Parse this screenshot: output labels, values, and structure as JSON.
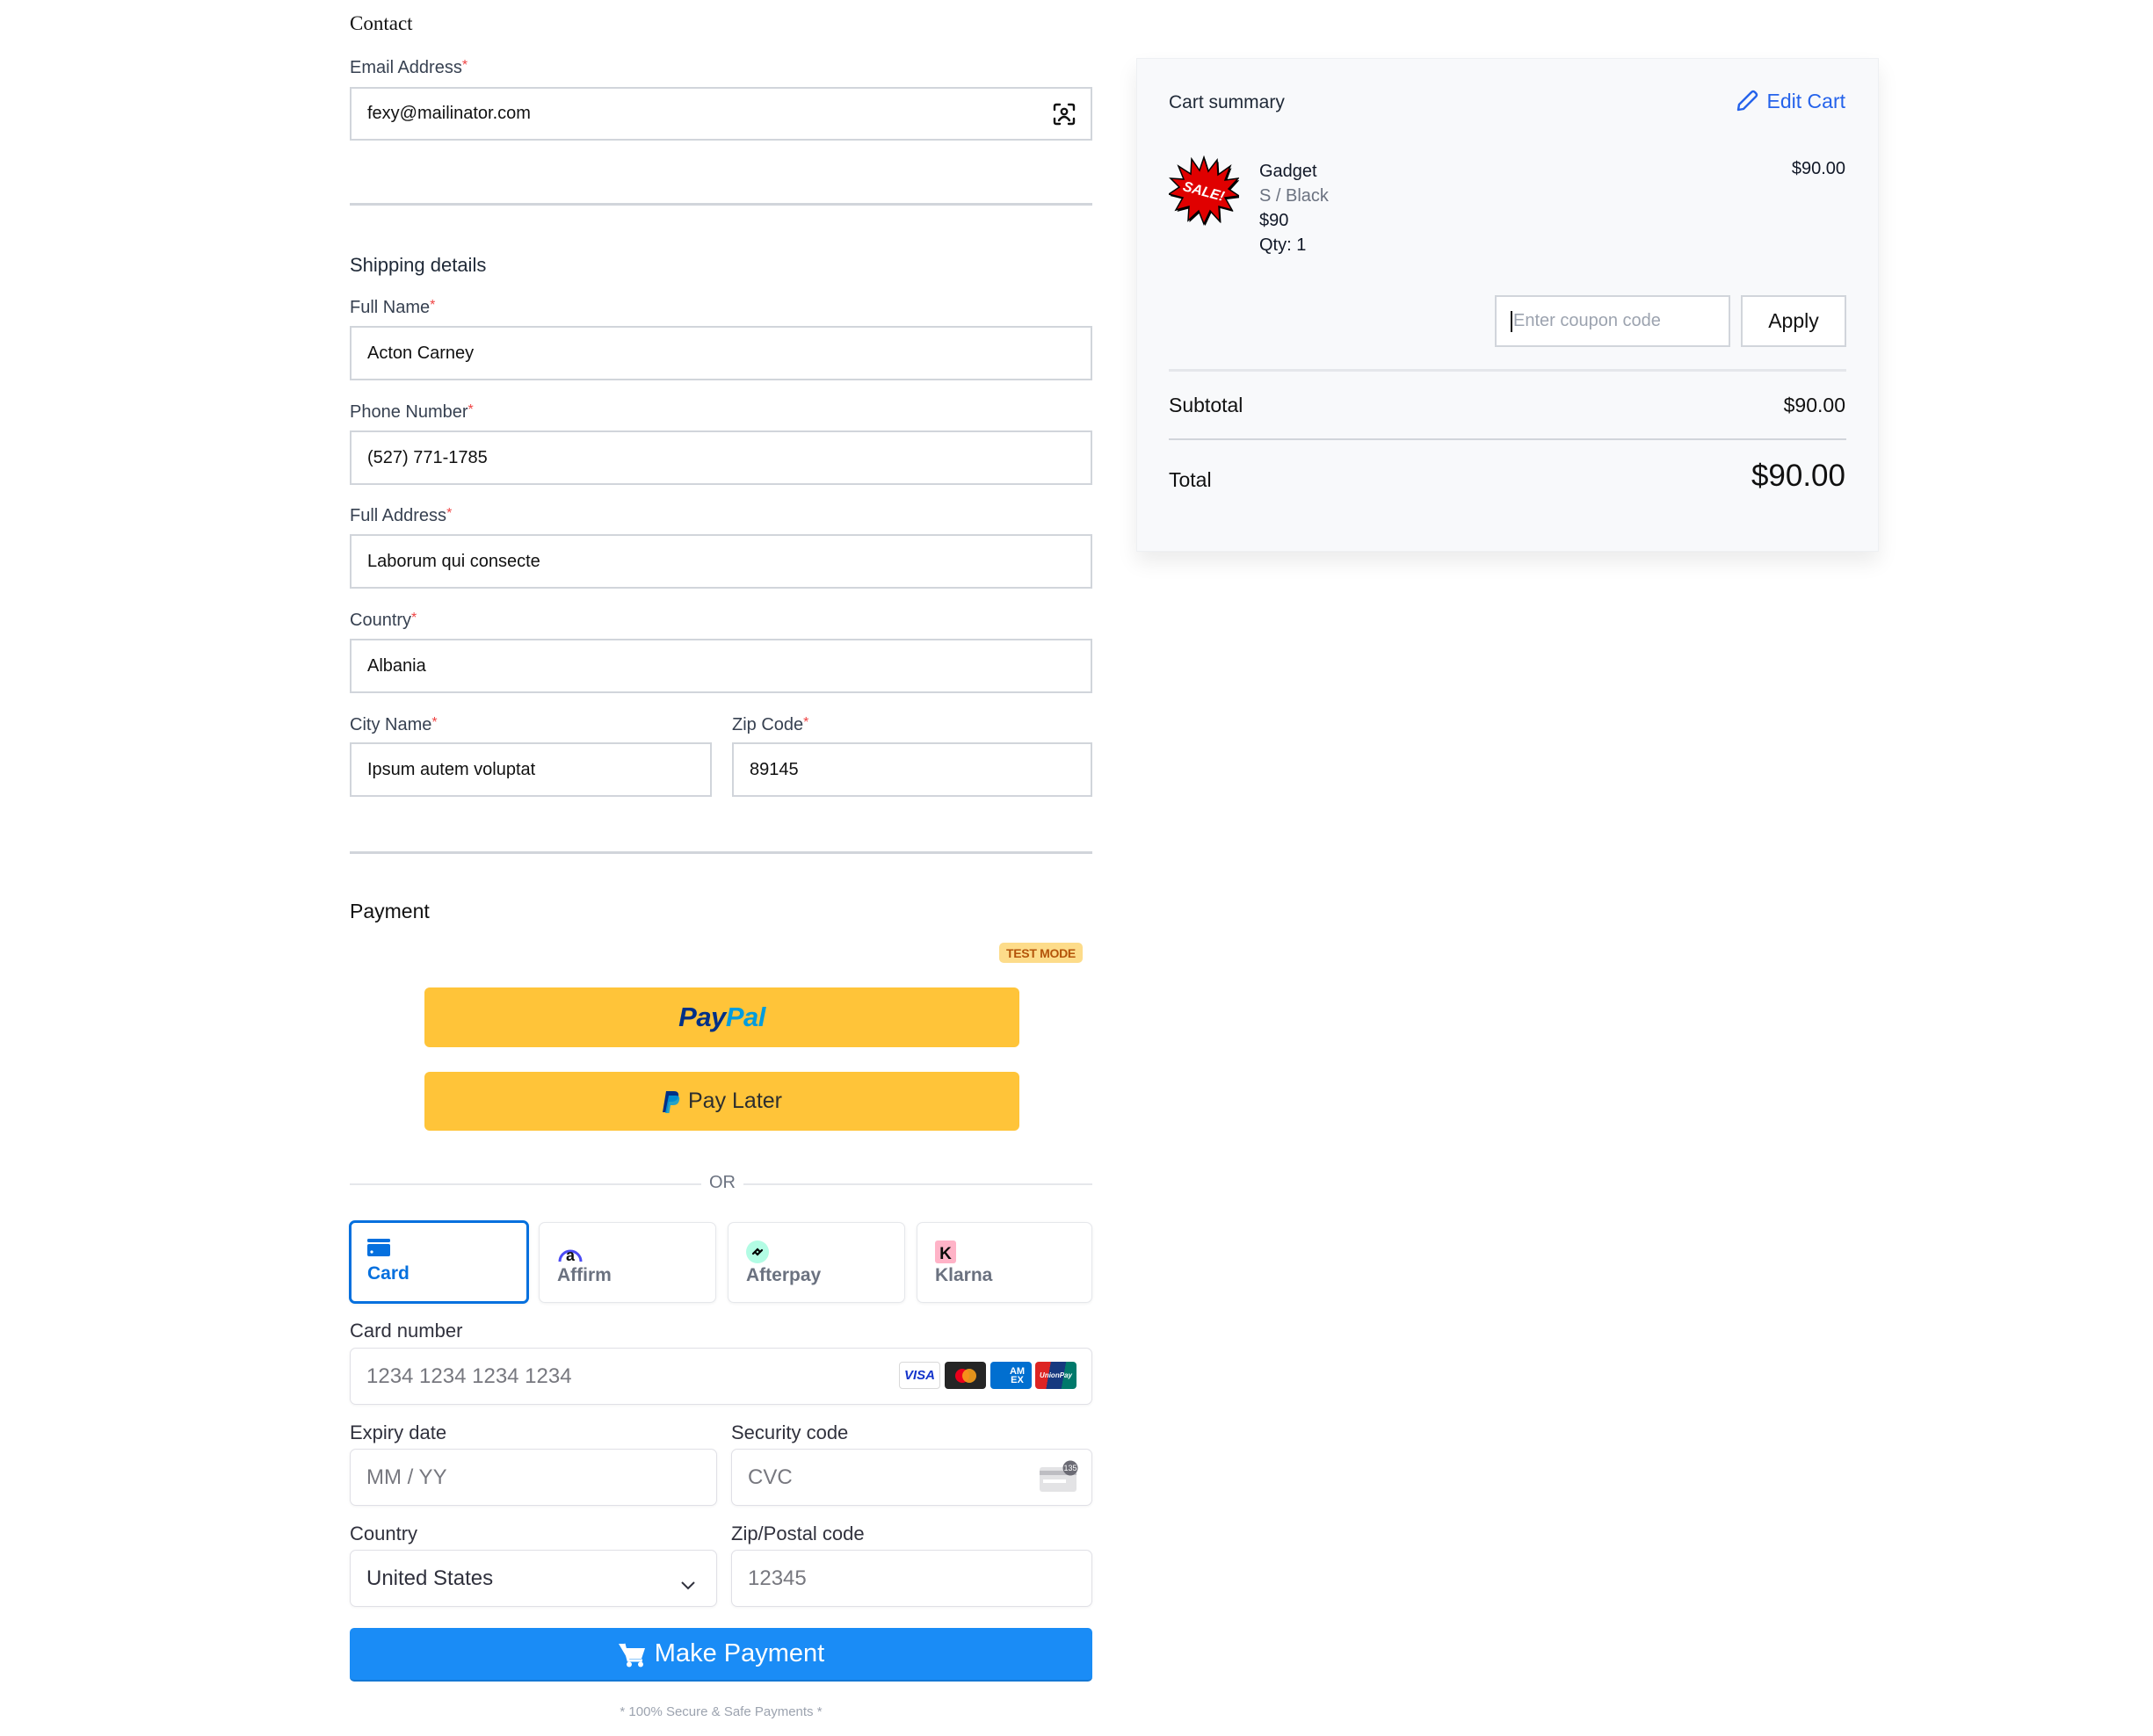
{
  "contact": {
    "title": "Contact",
    "email_label": "Email Address",
    "required_mark": "*",
    "email_value": "fexy@mailinator.com",
    "email_icon": "contact-autofill-icon"
  },
  "shipping": {
    "title": "Shipping details",
    "full_name_label": "Full Name",
    "full_name_value": "Acton Carney",
    "phone_label": "Phone Number",
    "phone_value": "(527) 771-1785",
    "address_label": "Full Address",
    "address_value": "Laborum qui consecte",
    "country_label": "Country",
    "country_value": "Albania",
    "city_label": "City Name",
    "city_value": "Ipsum autem voluptat",
    "zip_label": "Zip Code",
    "zip_value": "89145"
  },
  "payment": {
    "title": "Payment",
    "test_mode_badge": "TEST MODE",
    "paypal_button": {
      "pay": "Pay",
      "pal": "Pal"
    },
    "pay_later_button": "Pay Later",
    "or_separator": "OR",
    "methods": [
      {
        "label": "Card",
        "icon": "card-icon",
        "active": true
      },
      {
        "label": "Affirm",
        "icon": "affirm-icon",
        "active": false
      },
      {
        "label": "Afterpay",
        "icon": "afterpay-icon",
        "active": false
      },
      {
        "label": "Klarna",
        "icon": "klarna-icon",
        "active": false
      }
    ],
    "card_number_label": "Card number",
    "card_number_placeholder": "1234 1234 1234 1234",
    "card_brands": [
      "VISA",
      "Mastercard",
      "AMEX",
      "UnionPay"
    ],
    "expiry_label": "Expiry date",
    "expiry_placeholder": "MM / YY",
    "security_label": "Security code",
    "security_placeholder": "CVC",
    "cvc_icon_text": "135",
    "country_label": "Country",
    "country_value": "United States",
    "zip_label": "Zip/Postal code",
    "zip_placeholder": "12345",
    "submit_button": "Make Payment",
    "secure_note": "* 100% Secure & Safe Payments *",
    "colors": {
      "paypal_yellow": "#FFC439",
      "stripe_blue": "#0570DE",
      "submit_blue": "#1A8CF6"
    }
  },
  "cart": {
    "title": "Cart summary",
    "edit_link": "Edit Cart",
    "item": {
      "badge_text": "SALE!",
      "name": "Gadget",
      "variant": "S / Black",
      "unit_price": "$90",
      "qty": "Qty: 1",
      "line_total": "$90.00"
    },
    "coupon_placeholder": "Enter coupon code",
    "apply_button": "Apply",
    "subtotal_label": "Subtotal",
    "subtotal_value": "$90.00",
    "total_label": "Total",
    "total_value": "$90.00",
    "accent_color": "#2563EB"
  }
}
